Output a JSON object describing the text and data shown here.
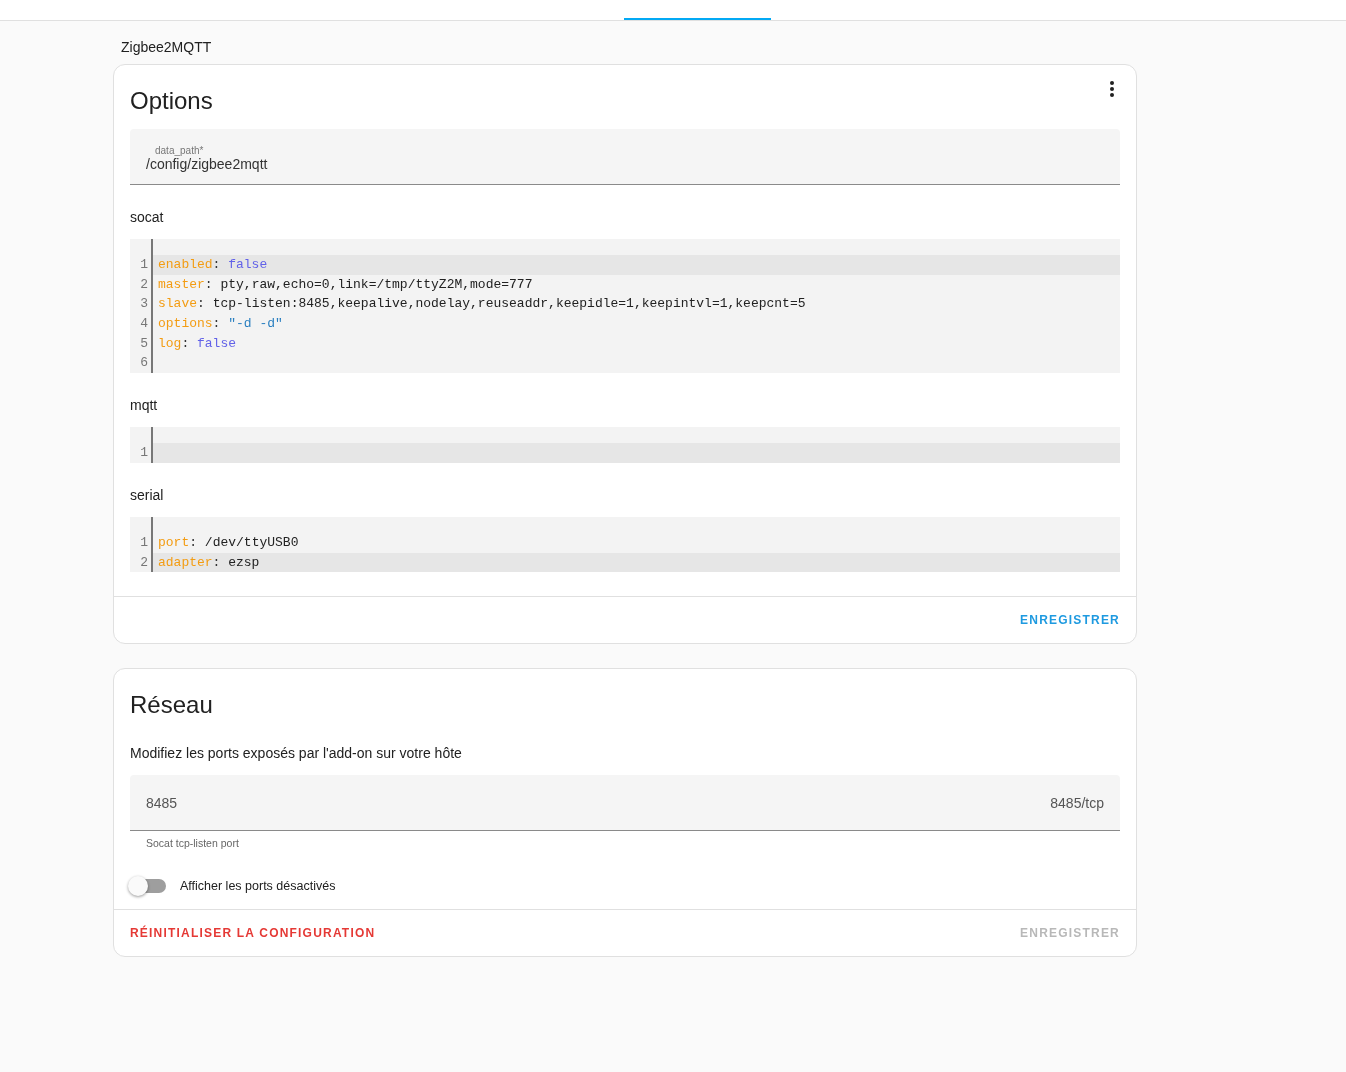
{
  "breadcrumb": "Zigbee2MQTT",
  "options_card": {
    "title": "Options",
    "field": {
      "label": "data_path*",
      "value": "/config/zigbee2mqtt"
    },
    "editors": [
      {
        "label": "socat",
        "lines": [
          {
            "number": "1",
            "active": true,
            "tokens": [
              {
                "kind": "key",
                "text": "enabled"
              },
              {
                "kind": "punct",
                "text": ": "
              },
              {
                "kind": "bool",
                "text": "false"
              }
            ]
          },
          {
            "number": "2",
            "active": false,
            "tokens": [
              {
                "kind": "key",
                "text": "master"
              },
              {
                "kind": "punct",
                "text": ": "
              },
              {
                "kind": "plain",
                "text": "pty,raw,echo=0,link=/tmp/ttyZ2M,mode=777"
              }
            ]
          },
          {
            "number": "3",
            "active": false,
            "tokens": [
              {
                "kind": "key",
                "text": "slave"
              },
              {
                "kind": "punct",
                "text": ": "
              },
              {
                "kind": "plain",
                "text": "tcp-listen:8485,keepalive,nodelay,reuseaddr,keepidle=1,keepintvl=1,keepcnt=5"
              }
            ]
          },
          {
            "number": "4",
            "active": false,
            "tokens": [
              {
                "kind": "key",
                "text": "options"
              },
              {
                "kind": "punct",
                "text": ": "
              },
              {
                "kind": "string",
                "text": "\"-d -d\""
              }
            ]
          },
          {
            "number": "5",
            "active": false,
            "tokens": [
              {
                "kind": "key",
                "text": "log"
              },
              {
                "kind": "punct",
                "text": ": "
              },
              {
                "kind": "bool",
                "text": "false"
              }
            ]
          },
          {
            "number": "6",
            "active": false
          }
        ]
      },
      {
        "label": "mqtt",
        "lines": [
          {
            "number": "1",
            "active": true
          }
        ]
      },
      {
        "label": "serial",
        "lines": [
          {
            "number": "1",
            "active": false,
            "tokens": [
              {
                "kind": "key",
                "text": "port"
              },
              {
                "kind": "punct",
                "text": ": "
              },
              {
                "kind": "plain",
                "text": "/dev/ttyUSB0"
              }
            ]
          },
          {
            "number": "2",
            "active": true,
            "tokens": [
              {
                "kind": "key",
                "text": "adapter"
              },
              {
                "kind": "punct",
                "text": ": "
              },
              {
                "kind": "plain",
                "text": "ezsp"
              }
            ]
          }
        ]
      }
    ],
    "save": {
      "label": "ENREGISTRER",
      "disabled": false
    }
  },
  "network_card": {
    "title": "Réseau",
    "description": "Modifiez les ports exposés par l'add-on sur votre hôte",
    "ports": [
      {
        "value": "8485",
        "suffix": "8485/tcp",
        "helper": "Socat tcp-listen port"
      }
    ],
    "toggle": {
      "label": "Afficher les ports désactivés",
      "on": false
    },
    "reset": {
      "label": "RÉINITIALISER LA CONFIGURATION",
      "disabled": false
    },
    "save": {
      "label": "ENREGISTRER",
      "disabled": true
    }
  }
}
